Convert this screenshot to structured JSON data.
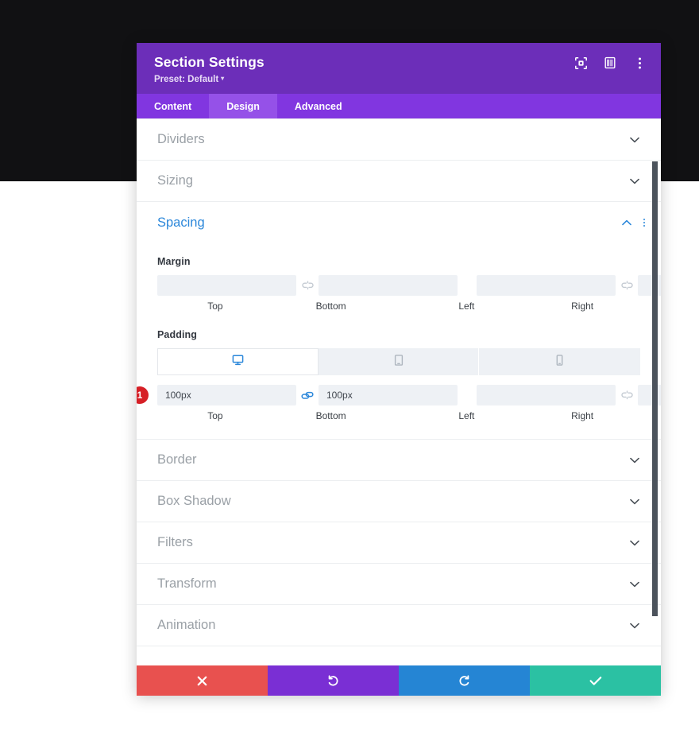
{
  "modal": {
    "title": "Section Settings",
    "preset_label": "Preset: Default",
    "header_icons": [
      {
        "name": "focus-target-icon"
      },
      {
        "name": "panel-layout-icon"
      },
      {
        "name": "kebab-menu-icon"
      }
    ],
    "tabs": [
      {
        "label": "Content",
        "active": false
      },
      {
        "label": "Design",
        "active": true
      },
      {
        "label": "Advanced",
        "active": false
      }
    ],
    "accordions_above": [
      {
        "label": "Dividers",
        "open": false
      },
      {
        "label": "Sizing",
        "open": false
      }
    ],
    "spacing": {
      "label": "Spacing",
      "open": true,
      "margin": {
        "label": "Margin",
        "top_value": "",
        "bottom_value": "",
        "left_value": "",
        "right_value": "",
        "top_label": "Top",
        "bottom_label": "Bottom",
        "left_label": "Left",
        "right_label": "Right",
        "vertical_linked": false,
        "horizontal_linked": false
      },
      "padding": {
        "label": "Padding",
        "devices": [
          {
            "name": "desktop-icon",
            "active": true
          },
          {
            "name": "tablet-icon",
            "active": false
          },
          {
            "name": "phone-icon",
            "active": false
          }
        ],
        "top_value": "100px",
        "bottom_value": "100px",
        "left_value": "",
        "right_value": "",
        "top_label": "Top",
        "bottom_label": "Bottom",
        "left_label": "Left",
        "right_label": "Right",
        "vertical_linked": true,
        "horizontal_linked": false,
        "step_badge": "1"
      }
    },
    "accordions_below": [
      {
        "label": "Border",
        "open": false
      },
      {
        "label": "Box Shadow",
        "open": false
      },
      {
        "label": "Filters",
        "open": false
      },
      {
        "label": "Transform",
        "open": false
      },
      {
        "label": "Animation",
        "open": false
      }
    ],
    "footer_buttons": [
      {
        "name": "cancel-button",
        "icon": "close-icon"
      },
      {
        "name": "undo-button",
        "icon": "undo-icon"
      },
      {
        "name": "redo-button",
        "icon": "redo-icon"
      },
      {
        "name": "save-button",
        "icon": "check-icon"
      }
    ]
  },
  "colors": {
    "header_purple": "#6C2EB9",
    "tabbar_purple": "#8136E0",
    "active_tab_purple": "#9551E8",
    "accent_blue": "#2B87DA",
    "badge_red": "#D61F26",
    "cancel_red": "#E8514F",
    "undo_purple": "#7A2FD4",
    "redo_blue": "#2585D4",
    "save_teal": "#2BC1A3"
  }
}
